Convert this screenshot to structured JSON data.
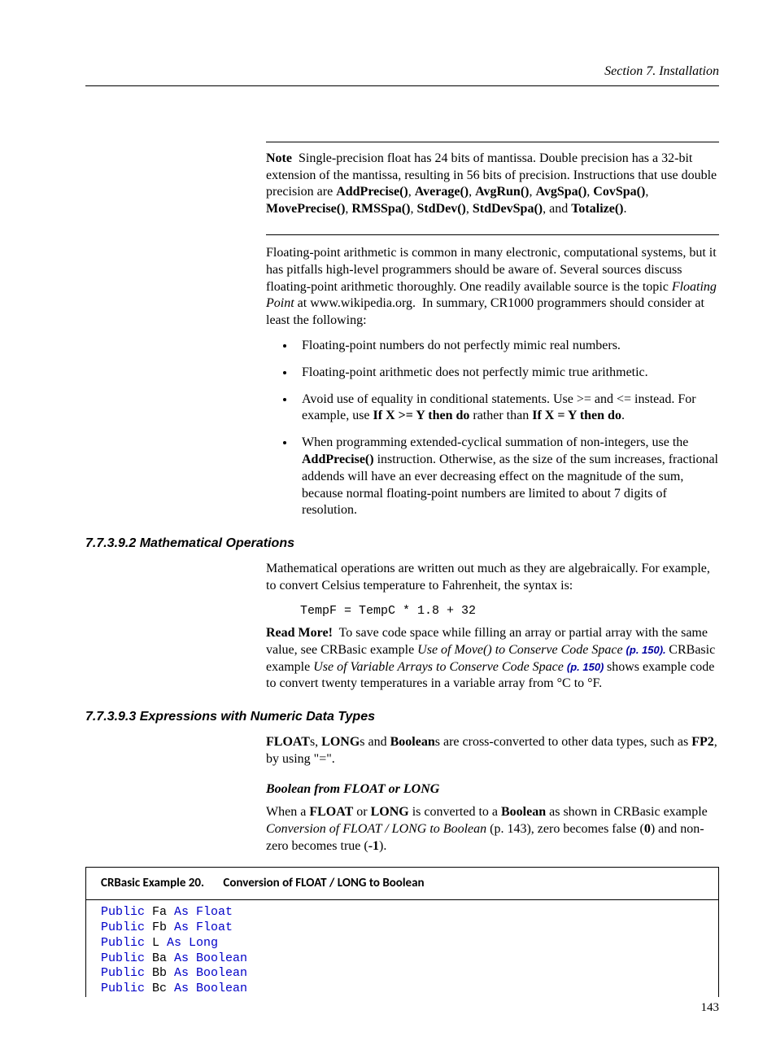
{
  "header": {
    "running": "Section 7.  Installation"
  },
  "note": {
    "text": "Note  Single-precision float has 24 bits of mantissa. Double precision has a 32-bit extension of the mantissa, resulting in 56 bits of precision. Instructions that use double precision are AddPrecise(), Average(), AvgRun(), AvgSpa(), CovSpa(), MovePrecise(), RMSSpa(), StdDev(), StdDevSpa(), and Totalize()."
  },
  "para1": "Floating-point arithmetic is common in many electronic, computational systems, but it has pitfalls high-level programmers should be aware of. Several sources discuss floating-point arithmetic thoroughly. One readily available source is the topic Floating Point at www.wikipedia.org.  In summary, CR1000 programmers should consider at least the following:",
  "bullets": [
    "Floating-point numbers do not perfectly mimic real numbers.",
    "Floating-point arithmetic does not perfectly mimic true arithmetic.",
    "Avoid use of equality in conditional statements. Use >= and <= instead. For example, use If X >= Y then do rather than If X = Y then do.",
    "When programming extended-cyclical summation of non-integers, use the AddPrecise() instruction. Otherwise, as the size of the sum increases, fractional addends will have an ever decreasing effect on the magnitude of the sum, because normal floating-point numbers are limited to about 7 digits of resolution."
  ],
  "sec2": {
    "heading": "7.7.3.9.2 Mathematical Operations",
    "para": "Mathematical operations are written out much as they are algebraically. For example, to convert Celsius temperature to Fahrenheit, the syntax is:",
    "code": "TempF = TempC * 1.8 + 32",
    "readmore_pre": "Read More!  To save code space while filling an array or partial array with the same value, see CRBasic example ",
    "readmore_em1": "Use of Move() to Conserve Code Space ",
    "ref1": "(p. 150). ",
    "readmore_mid": "CRBasic example ",
    "readmore_em2": "Use of Variable Arrays to Conserve Code Space ",
    "ref2": "(p. 150) ",
    "readmore_post": "shows example code to convert twenty temperatures in a variable array from °C to °F."
  },
  "sec3": {
    "heading": "7.7.3.9.3 Expressions with Numeric Data Types",
    "para1_pre": "FLOATs, LONGs and Booleans are cross-converted to other data types, such as FP2, by using \"=\".",
    "sub_heading": "Boolean from FLOAT or LONG",
    "para2": "When a FLOAT or LONG is converted to a Boolean as shown in CRBasic example Conversion of FLOAT / LONG to Boolean (p. 143), zero becomes false (0) and non-zero becomes true (-1)."
  },
  "example": {
    "label": "CRBasic Example 20.",
    "title": "Conversion of FLOAT / LONG to Boolean",
    "lines": [
      {
        "kw1": "Public",
        "v": " Fa ",
        "kw2": "As Float"
      },
      {
        "kw1": "Public",
        "v": " Fb ",
        "kw2": "As Float"
      },
      {
        "kw1": "Public",
        "v": " L ",
        "kw2": "As Long"
      },
      {
        "kw1": "Public",
        "v": " Ba ",
        "kw2": "As Boolean"
      },
      {
        "kw1": "Public",
        "v": " Bb ",
        "kw2": "As Boolean"
      },
      {
        "kw1": "Public",
        "v": " Bc ",
        "kw2": "As Boolean"
      }
    ]
  },
  "page_number": "143"
}
